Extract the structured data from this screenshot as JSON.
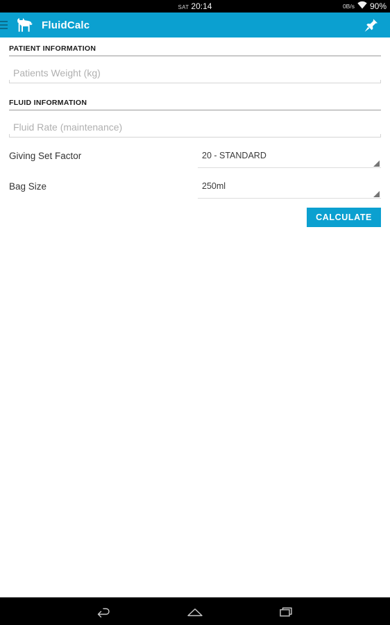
{
  "status_bar": {
    "day": "SAT",
    "time": "20:14",
    "network_speed": "0B/s",
    "wifi_icon": "wifi-icon",
    "battery": "90%"
  },
  "app_bar": {
    "drawer_icon": "hamburger-menu-icon",
    "logo_icon": "dog-logo-icon",
    "title": "FluidCalc",
    "action_icon": "pin-icon"
  },
  "colors": {
    "accent": "#0ba0d0",
    "status_bar_bg": "#000000",
    "page_bg": "#ffffff",
    "divider": "#9a9a9a",
    "placeholder": "#b0b0b0"
  },
  "form": {
    "sections": [
      {
        "title": "PATIENT INFORMATION",
        "fields": [
          {
            "name": "patients-weight",
            "type": "text",
            "value": "",
            "placeholder": "Patients Weight (kg)"
          }
        ]
      },
      {
        "title": "FLUID INFORMATION",
        "fields": [
          {
            "name": "fluid-rate",
            "type": "text",
            "value": "",
            "placeholder": "Fluid Rate (maintenance)"
          }
        ]
      }
    ],
    "spinners": [
      {
        "name": "giving-set-factor",
        "label": "Giving Set Factor",
        "selected": "20 - STANDARD"
      },
      {
        "name": "bag-size",
        "label": "Bag Size",
        "selected": "250ml"
      }
    ],
    "submit_label": "CALCULATE"
  },
  "nav_bar": {
    "back_icon": "back-arrow-icon",
    "home_icon": "home-icon",
    "recents_icon": "recent-apps-icon"
  }
}
